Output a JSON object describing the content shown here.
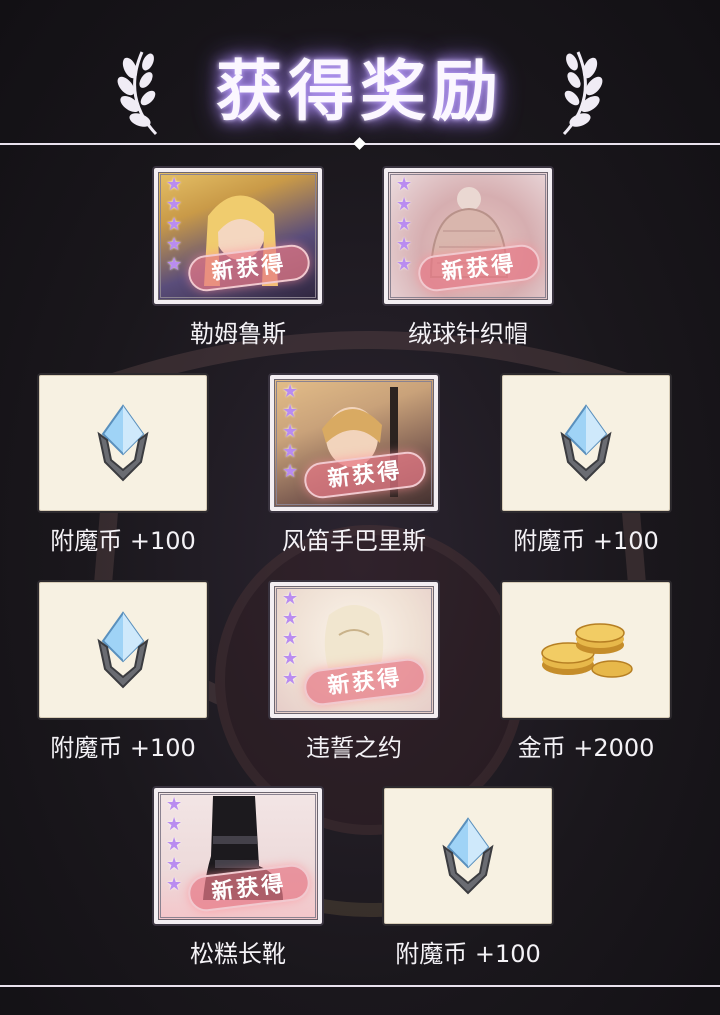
{
  "header": {
    "title": "获得奖励"
  },
  "badge_text": "新获得",
  "star_count": 5,
  "colors": {
    "accent": "#b89aff",
    "card_bg": "#f7f1e2",
    "badge": "#e67887",
    "star": "#b98cf0"
  },
  "rewards": [
    {
      "label": "勒姆鲁斯",
      "type": "character",
      "is_new": true
    },
    {
      "label": "绒球针织帽",
      "type": "costume",
      "is_new": true
    },
    {
      "label": "附魔币 +100",
      "type": "currency",
      "icon": "enchant-coin-icon"
    },
    {
      "label": "风笛手巴里斯",
      "type": "character",
      "is_new": true
    },
    {
      "label": "附魔币 +100",
      "type": "currency",
      "icon": "enchant-coin-icon"
    },
    {
      "label": "附魔币 +100",
      "type": "currency",
      "icon": "enchant-coin-icon"
    },
    {
      "label": "违誓之约",
      "type": "card",
      "is_new": true
    },
    {
      "label": "金币 +2000",
      "type": "currency",
      "icon": "gold-coins-icon"
    },
    {
      "label": "松糕长靴",
      "type": "costume",
      "is_new": true
    },
    {
      "label": "附魔币 +100",
      "type": "currency",
      "icon": "enchant-coin-icon"
    }
  ]
}
